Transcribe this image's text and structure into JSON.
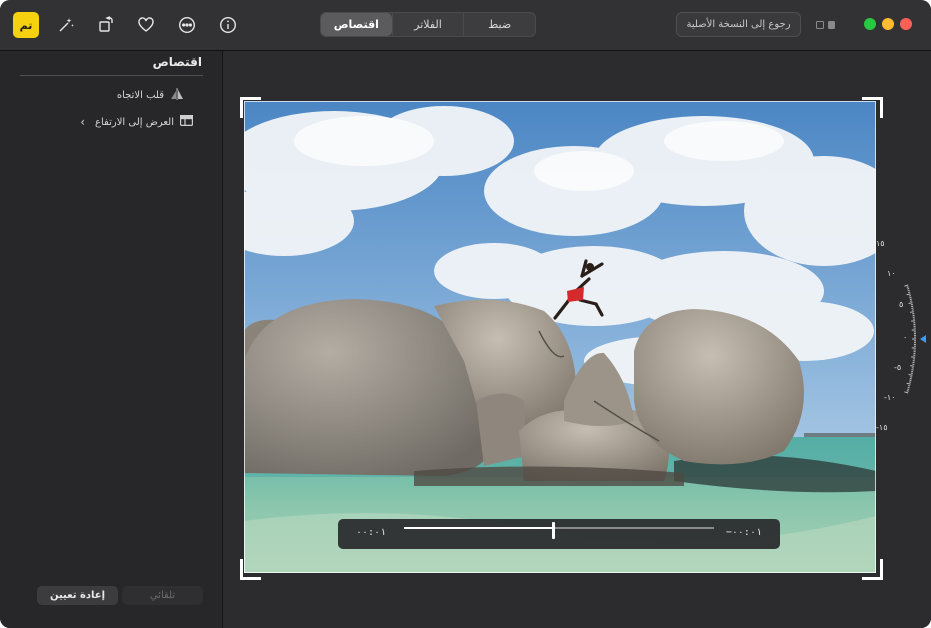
{
  "toolbar": {
    "done_label": "تم",
    "tabs": [
      {
        "label": "ضبط",
        "active": false
      },
      {
        "label": "الفلاتر",
        "active": false
      },
      {
        "label": "اقتصاص",
        "active": true
      }
    ],
    "revert_label": "رجوع إلى النسخة الأصلية",
    "icons": [
      "magic-wand-icon",
      "rotate-icon",
      "heart-icon",
      "more-icon",
      "info-icon"
    ],
    "colors": {
      "accent": "#f5d10f",
      "close": "#fe5f57",
      "minimize": "#febc2e",
      "zoom": "#28c840"
    }
  },
  "sidebar": {
    "title": "اقتصاص",
    "items": [
      {
        "label": "قلب الاتجاه",
        "icon": "flip-icon"
      },
      {
        "label": "العرض إلى الارتفاع",
        "icon": "aspect-ratio-icon"
      }
    ],
    "auto_label": "تلقائي",
    "reset_label": "إعادة تعيين"
  },
  "scrubber": {
    "left_value": "٠٠:٠١",
    "right_value": "−٠٠:٠١",
    "progress": 0.48
  },
  "dial": {
    "labels": [
      "١٥",
      "١٠",
      "٥",
      "٠",
      "-٥",
      "-١٠",
      "-١٥"
    ],
    "value": 0
  }
}
